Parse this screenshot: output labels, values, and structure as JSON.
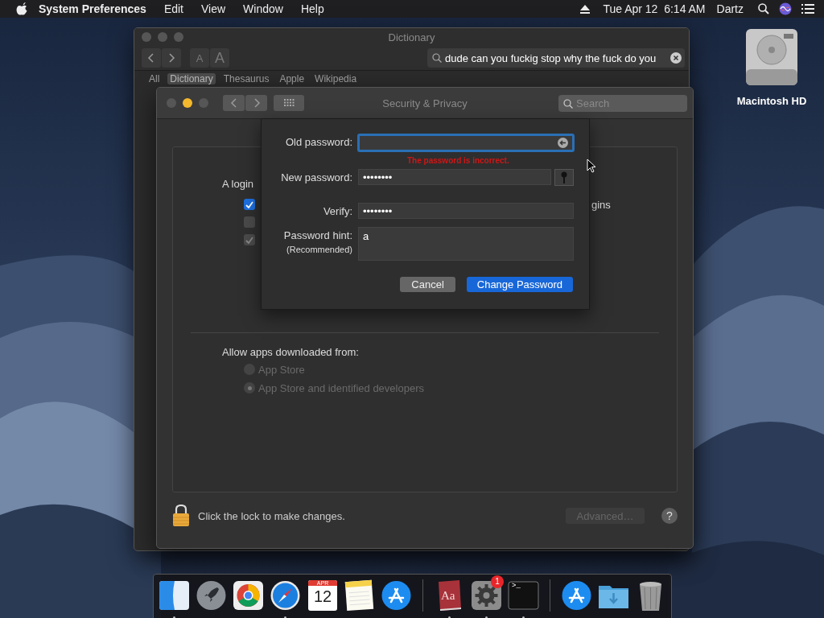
{
  "menu_bar": {
    "app": "System Preferences",
    "menus": [
      "Edit",
      "View",
      "Window",
      "Help"
    ],
    "clock": "Tue Apr 12  6:14 AM",
    "user": "Dartz"
  },
  "desktop_icons": [
    {
      "label": "Macintosh HD"
    }
  ],
  "dictionary_window": {
    "title": "Dictionary",
    "font_buttons": [
      "A",
      "A"
    ],
    "search_query": "dude can you fuckig stop why the fuck do you",
    "tabs": [
      {
        "label": "All",
        "selected": false
      },
      {
        "label": "Dictionary",
        "selected": true
      },
      {
        "label": "Thesaurus",
        "selected": false
      },
      {
        "label": "Apple",
        "selected": false
      },
      {
        "label": "Wikipedia",
        "selected": false
      }
    ]
  },
  "security_window": {
    "title": "Security & Privacy",
    "search": {
      "placeholder": "Search"
    },
    "login_text": "A login",
    "checkboxes": [
      {
        "checked": true,
        "disabled": false
      },
      {
        "checked": false,
        "disabled": true
      },
      {
        "checked": true,
        "disabled": true
      }
    ],
    "checkbox_fragment": "gins",
    "allow_heading": "Allow apps downloaded from:",
    "radios": [
      {
        "label": "App Store",
        "selected": false,
        "disabled": true
      },
      {
        "label": "App Store and identified developers",
        "selected": true,
        "disabled": true
      }
    ],
    "locked": true,
    "lock_text": "Click the lock to make changes.",
    "advanced_button": {
      "label": "Advanced…",
      "disabled": true
    },
    "help": "?"
  },
  "password_sheet": {
    "fields": [
      {
        "kind": "password",
        "label": "Old password:",
        "focused": true,
        "error": "The password is incorrect."
      },
      {
        "kind": "password",
        "label": "New password:",
        "value": "••••••••",
        "focused": false,
        "assistant": true
      },
      {
        "kind": "password",
        "label": "Verify:",
        "value": "••••••••",
        "focused": false
      },
      {
        "kind": "hint",
        "label": "Password hint:",
        "sublabel": "(Recommended)",
        "value": "a",
        "focused": false
      }
    ],
    "buttons": [
      {
        "label": "Cancel",
        "default": false
      },
      {
        "label": "Change Password",
        "default": true
      }
    ]
  },
  "dock": [
    {
      "kind": "split",
      "running": true
    },
    {
      "kind": "rocket",
      "running": false
    },
    {
      "kind": "wheel",
      "running": false
    },
    {
      "kind": "compass",
      "running": true
    },
    {
      "kind": "calendar",
      "month": "APR",
      "day": "12",
      "running": false
    },
    {
      "kind": "notes",
      "running": false
    },
    {
      "kind": "store",
      "running": false
    },
    {
      "kind": "separator"
    },
    {
      "kind": "book",
      "glyph": "Aa",
      "running": true
    },
    {
      "kind": "gear",
      "badge": "1",
      "running": true
    },
    {
      "kind": "terminal",
      "glyph": ">_",
      "running": true
    },
    {
      "kind": "separator"
    },
    {
      "kind": "store",
      "running": false
    },
    {
      "kind": "folder",
      "running": false
    },
    {
      "kind": "trash",
      "running": false
    }
  ]
}
